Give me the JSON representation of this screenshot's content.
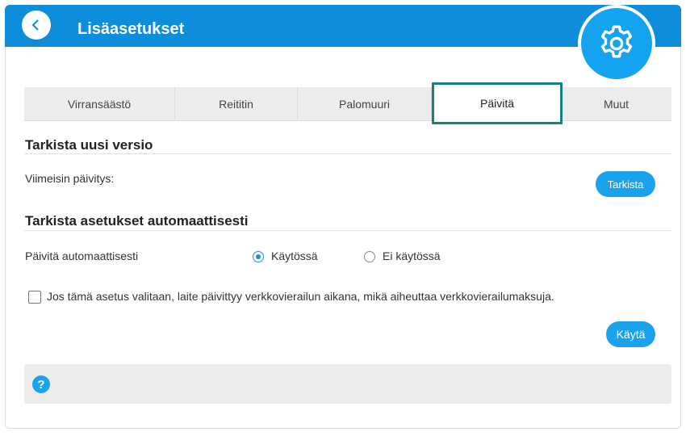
{
  "header": {
    "title": "Lisäasetukset",
    "back_icon": "back-arrow-icon",
    "settings_icon": "gear-icon",
    "color": "#0e8ddb"
  },
  "tabs": [
    {
      "label": "Virransäästö",
      "active": false
    },
    {
      "label": "Reititin",
      "active": false
    },
    {
      "label": "Palomuuri",
      "active": false
    },
    {
      "label": "Päivitä",
      "active": true
    },
    {
      "label": "Muut",
      "active": false
    }
  ],
  "check_version": {
    "title": "Tarkista uusi versio",
    "last_update_label": "Viimeisin päivitys:",
    "check_button": "Tarkista"
  },
  "auto_update": {
    "title": "Tarkista asetukset automaattisesti",
    "label": "Päivitä automaattisesti",
    "option_on": "Käytössä",
    "option_off": "Ei käytössä",
    "selected": "Käytössä",
    "roaming_note": "Jos tämä asetus valitaan, laite päivittyy verkkovierailun aikana, mikä aiheuttaa verkkovierailumaksuja.",
    "roaming_checked": false,
    "apply_button": "Käytä"
  },
  "help": {
    "icon": "help-icon",
    "glyph": "?"
  },
  "accent_color": "#1aa3ec",
  "active_tab_border": "#14837a"
}
